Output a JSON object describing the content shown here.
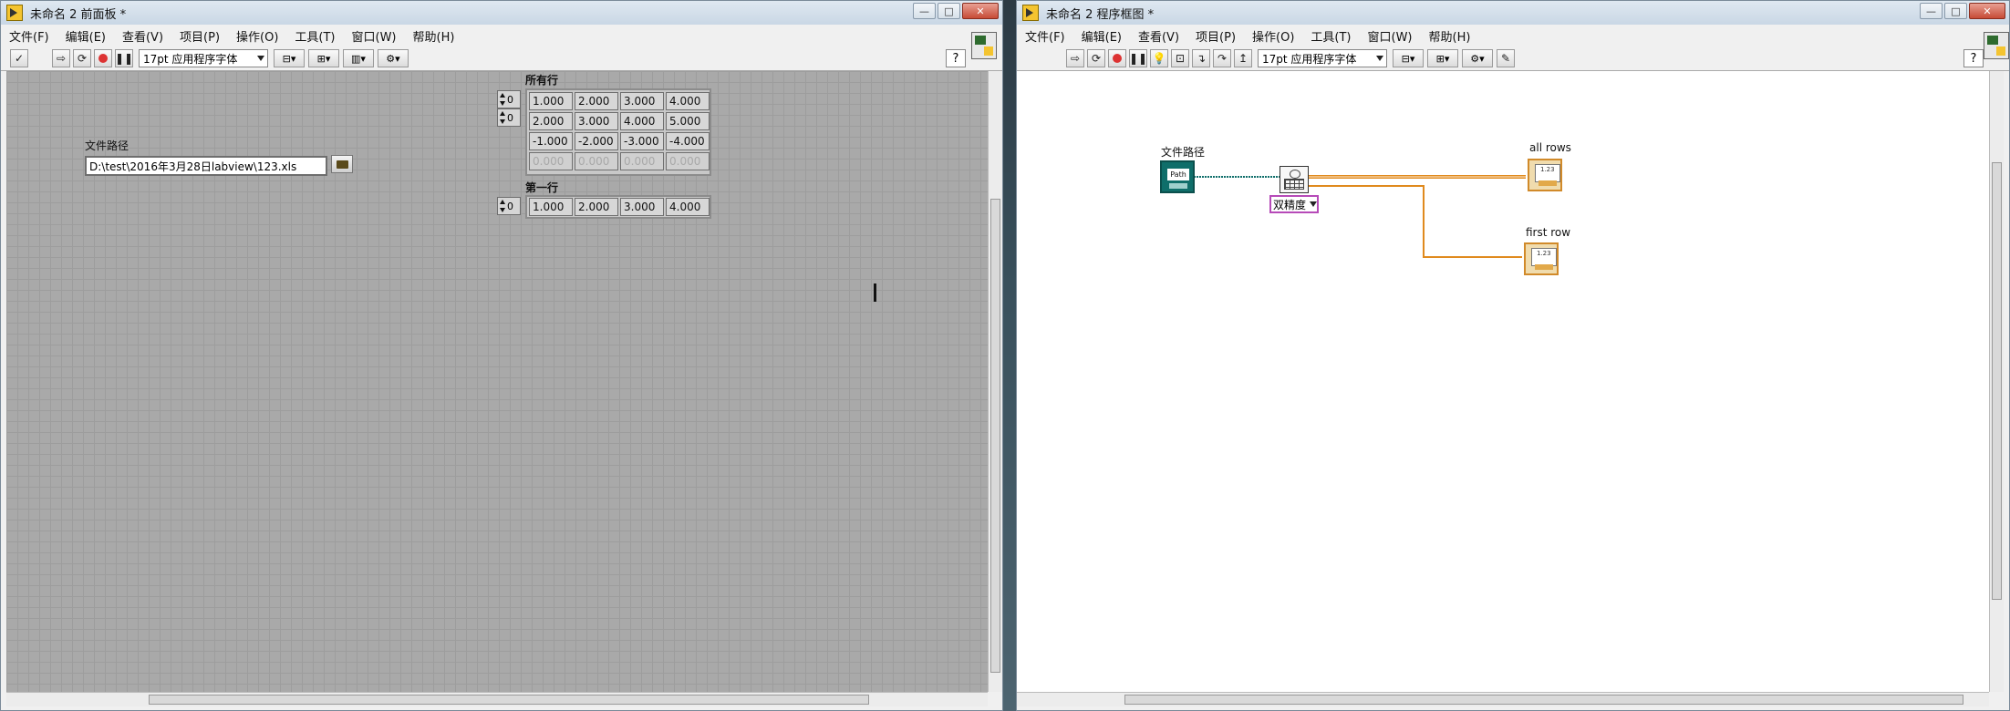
{
  "front_panel_window": {
    "title": "未命名 2 前面板 *",
    "controls": {
      "minimize": "—",
      "maximize": "□",
      "close": "✕"
    },
    "menu": [
      "文件(F)",
      "编辑(E)",
      "查看(V)",
      "项目(P)",
      "操作(O)",
      "工具(T)",
      "窗口(W)",
      "帮助(H)"
    ],
    "toolbar": {
      "font": "17pt 应用程序字体",
      "help": "?",
      "connector_num": "2"
    },
    "file_path_control": {
      "label": "文件路径",
      "value": "D:\\test\\2016年3月28日labview\\123.xls"
    },
    "all_rows": {
      "label": "所有行",
      "row_index": "0",
      "col_index": "0",
      "rows": [
        [
          "1.000",
          "2.000",
          "3.000",
          "4.000"
        ],
        [
          "2.000",
          "3.000",
          "4.000",
          "5.000"
        ],
        [
          "-1.000",
          "-2.000",
          "-3.000",
          "-4.000"
        ],
        [
          "0.000",
          "0.000",
          "0.000",
          "0.000"
        ]
      ]
    },
    "first_row": {
      "label": "第一行",
      "index": "0",
      "values": [
        "1.000",
        "2.000",
        "3.000",
        "4.000"
      ]
    }
  },
  "block_diagram_window": {
    "title": "未命名 2 程序框图 *",
    "controls": {
      "minimize": "—",
      "maximize": "□",
      "close": "✕"
    },
    "menu": [
      "文件(F)",
      "编辑(E)",
      "查看(V)",
      "项目(P)",
      "操作(O)",
      "窗口(W)",
      "帮助(H)"
    ],
    "menu_extra": "工具(T)",
    "toolbar": {
      "font": "17pt 应用程序字体",
      "help": "?",
      "connector_num": "2"
    },
    "nodes": {
      "path_control_label": "文件路径",
      "path_control_icon": "Path",
      "polymorphic_selector": "双精度",
      "all_rows_label": "all rows",
      "first_row_label": "first row",
      "indicator_icon_text": "1.23",
      "indicator_icon_type": "DBL"
    },
    "wire_colors": {
      "path": "#0f6e6a",
      "double": "#e08a1e"
    }
  }
}
